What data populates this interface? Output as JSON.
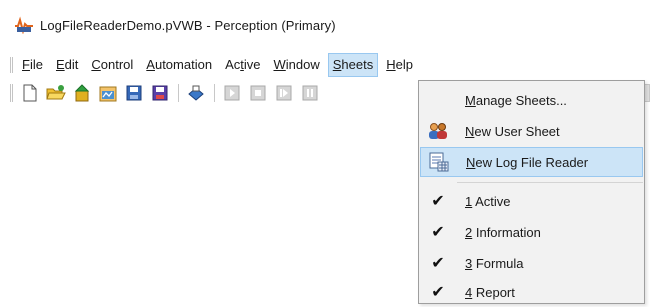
{
  "window": {
    "title": "LogFileReaderDemo.pVWB - Perception (Primary)",
    "icon": "perception-app-icon"
  },
  "menubar": {
    "items": [
      {
        "accel": "F",
        "rest": "ile",
        "name": "file"
      },
      {
        "accel": "E",
        "rest": "dit",
        "name": "edit"
      },
      {
        "accel": "C",
        "rest": "ontrol",
        "name": "control"
      },
      {
        "accel": "A",
        "rest": "utomation",
        "name": "automation"
      },
      {
        "pre": "Ac",
        "accel": "t",
        "rest": "ive",
        "name": "active"
      },
      {
        "accel": "W",
        "rest": "indow",
        "name": "window"
      },
      {
        "accel": "S",
        "rest": "heets",
        "name": "sheets"
      },
      {
        "accel": "H",
        "rest": "elp",
        "name": "help"
      }
    ],
    "active_item": "Sheets"
  },
  "toolbar": {
    "buttons": [
      "new-file-icon",
      "open-folder-icon",
      "import-icon",
      "open-window-icon",
      "save-icon",
      "save-as-icon",
      "print-icon",
      "play-icon",
      "stop-icon",
      "step-icon",
      "pause-icon"
    ]
  },
  "sheets_menu": {
    "items": [
      {
        "pre": "",
        "accel": "M",
        "rest": "anage Sheets...",
        "icon": "none",
        "checked": false
      },
      {
        "pre": "",
        "accel": "N",
        "rest": "ew User Sheet",
        "icon": "users-icon",
        "checked": false
      },
      {
        "pre": "",
        "accel": "N",
        "rest": "ew Log File Reader",
        "icon": "log-reader-icon",
        "checked": false
      },
      {
        "pre": "",
        "accel": "1",
        "rest": " Active",
        "icon": "check-icon",
        "checked": true
      },
      {
        "pre": "",
        "accel": "2",
        "rest": " Information",
        "icon": "check-icon",
        "checked": true
      },
      {
        "pre": "",
        "accel": "3",
        "rest": " Formula",
        "icon": "check-icon",
        "checked": true
      },
      {
        "pre": "",
        "accel": "4",
        "rest": " Report",
        "icon": "check-icon",
        "checked": true
      }
    ],
    "hovered_index": 2
  },
  "colors": {
    "highlight_bg": "#cce4f7",
    "highlight_border": "#99c8f0",
    "menu_bg": "#f2f2f2"
  }
}
